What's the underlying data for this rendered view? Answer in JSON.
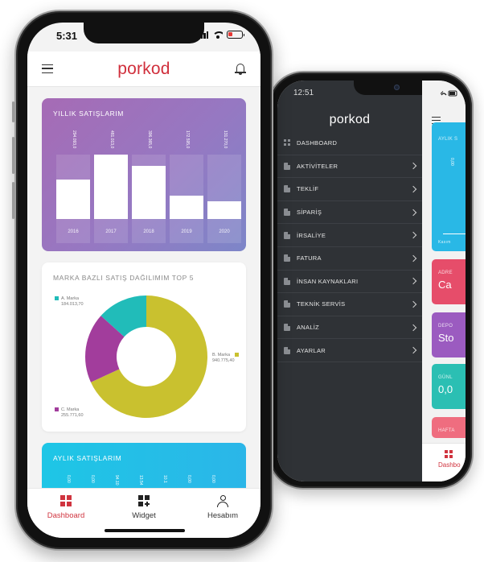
{
  "app": {
    "logo": "porkod"
  },
  "front": {
    "status_time": "5:31",
    "yearly": {
      "title": "YILLIK SATIŞLARIM",
      "years": [
        "2016",
        "2017",
        "2018",
        "2019",
        "2020"
      ],
      "values": [
        2940930,
        4810130,
        3963650,
        1725950,
        1312700
      ],
      "value_labels": [
        "294.093,0",
        "481.013,0",
        "396.365,0",
        "172.595,0",
        "131.270,0"
      ]
    },
    "brand": {
      "title": "MARKA BAZLI SATIŞ DAĞILIMIM TOP 5",
      "segments": [
        {
          "name": "A. Marka",
          "value_label": "184.013,70",
          "value": 184013.7,
          "color": "#21bcb9"
        },
        {
          "name": "B. Marka",
          "value_label": "940.775,40",
          "value": 940775.4,
          "color": "#c9c12f"
        },
        {
          "name": "C. Marka",
          "value_label": "255.771,60",
          "value": 255771.6,
          "color": "#a23d9c"
        }
      ]
    },
    "monthly": {
      "title": "AYLIK SATIŞLARIM",
      "value_labels": [
        "0,00",
        "0,00",
        "94.10",
        "13.54",
        "10.1",
        "0,00",
        "0,00"
      ]
    },
    "nav": [
      {
        "label": "Dashboard",
        "icon": "dashboard-icon",
        "active": true
      },
      {
        "label": "Widget",
        "icon": "widget-add-icon",
        "active": false
      },
      {
        "label": "Hesabım",
        "icon": "user-icon",
        "active": false
      }
    ]
  },
  "back": {
    "status_time": "12:51",
    "menu": [
      {
        "label": "DASHBOARD",
        "chevron": false
      },
      {
        "label": "AKTİVİTELER",
        "chevron": true
      },
      {
        "label": "TEKLİF",
        "chevron": true
      },
      {
        "label": "SİPARİŞ",
        "chevron": true
      },
      {
        "label": "İRSALİYE",
        "chevron": true
      },
      {
        "label": "FATURA",
        "chevron": true
      },
      {
        "label": "İNSAN KAYNAKLARI",
        "chevron": true
      },
      {
        "label": "TEKNİK SERVİS",
        "chevron": true
      },
      {
        "label": "ANALİZ",
        "chevron": true
      },
      {
        "label": "AYARLAR",
        "chevron": true
      }
    ],
    "cards": [
      {
        "title": "AYLIK S",
        "value": "",
        "sub_value": "0,00",
        "footer": "Kasım",
        "color": "#29b8e6"
      },
      {
        "title": "ADRE",
        "value": "Ca",
        "color": "#e64d6a"
      },
      {
        "title": "DEPO",
        "value": "Sto",
        "color": "#9b5bc0"
      },
      {
        "title": "GÜNL",
        "value": "0,0",
        "color": "#2bbfb3"
      },
      {
        "title": "HAFTA",
        "value": "",
        "color": "#ef6d7f"
      }
    ],
    "nav_label": "Dashbo"
  },
  "colors": {
    "brand_red": "#d0343f",
    "drawer_bg": "#2f3236"
  }
}
